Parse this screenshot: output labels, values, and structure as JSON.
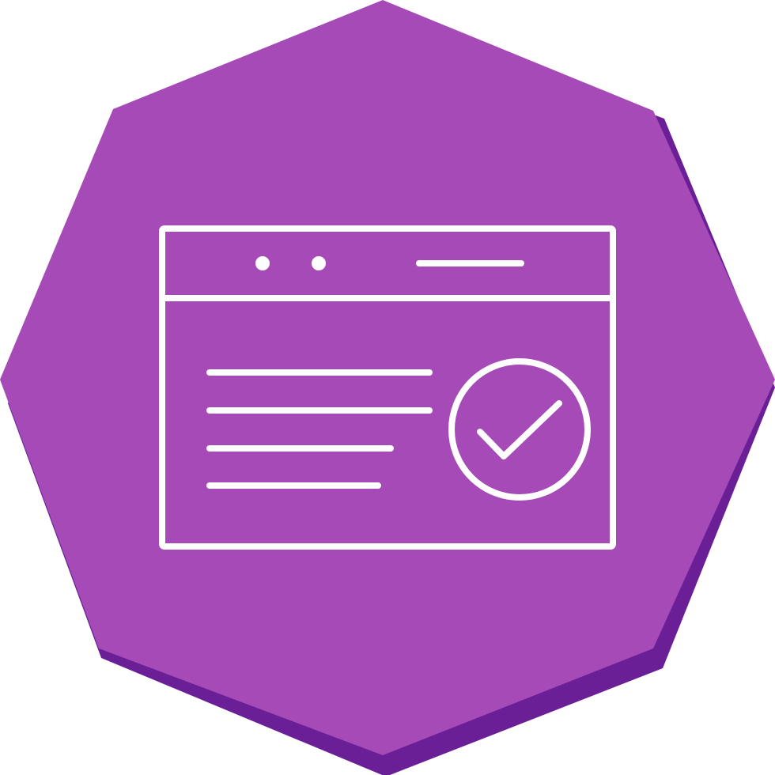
{
  "icon": {
    "name": "website-verified-icon",
    "badge_shape": "octagon",
    "colors": {
      "badge_fill": "#a64ab8",
      "badge_shadow": "#6b1f97",
      "line": "#ffffff",
      "page_background": "#ffffff"
    },
    "parts": [
      "browser-window-icon",
      "window-dot-icon",
      "address-bar-line",
      "text-line",
      "check-circle-icon",
      "checkmark-icon"
    ]
  }
}
